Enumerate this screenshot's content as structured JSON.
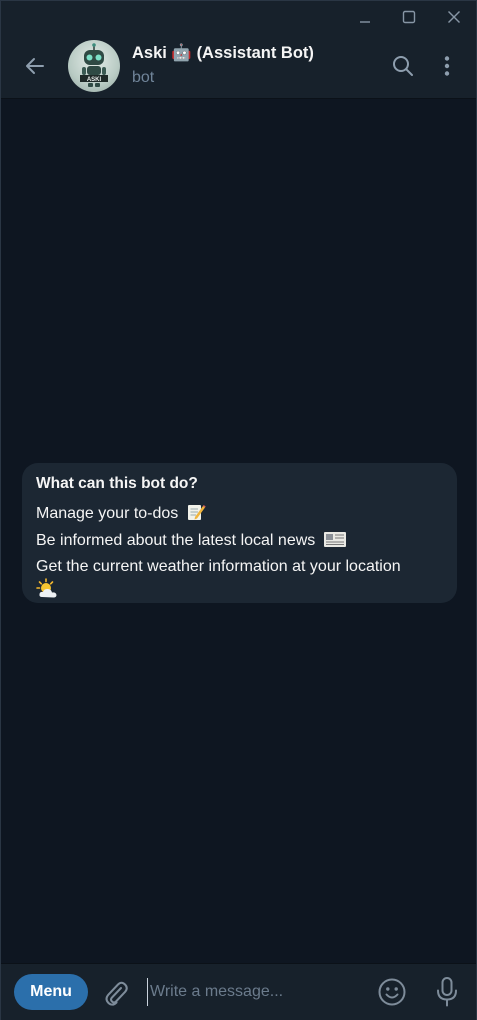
{
  "window_controls": {
    "minimize": "minimize-icon",
    "maximize": "maximize-icon",
    "close": "close-icon"
  },
  "header": {
    "title": "Aski 🤖 (Assistant Bot)",
    "status": "bot",
    "avatar_text": "ASKI"
  },
  "bot_info": {
    "title": "What can this bot do?",
    "lines": [
      "Manage your to-dos",
      "Be informed about the latest local news",
      "Get the current weather information at your location"
    ],
    "line_emojis": [
      "📝",
      "📰",
      "🌤️"
    ]
  },
  "composer": {
    "menu_label": "Menu",
    "placeholder": "Write a message..."
  },
  "colors": {
    "background": "#0e1621",
    "panel": "#17212b",
    "card": "#1c2733",
    "accent": "#2b6fab",
    "muted_text": "#708499",
    "icon": "#aab6c2"
  }
}
